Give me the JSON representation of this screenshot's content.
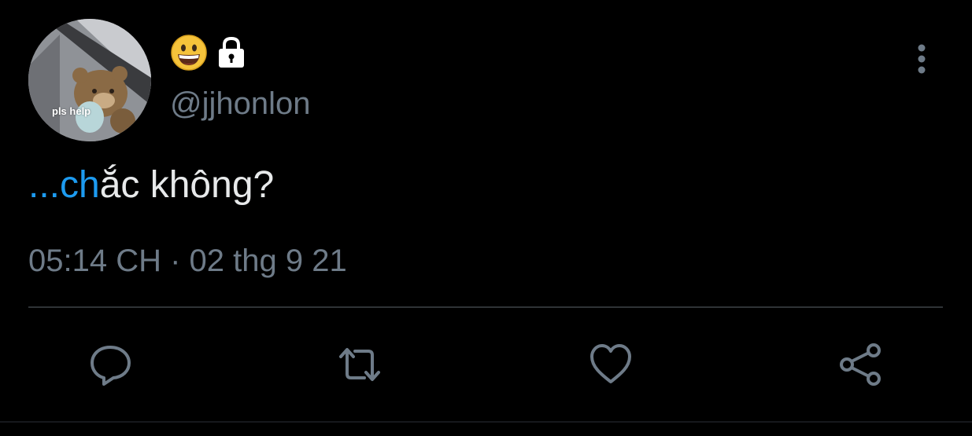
{
  "author": {
    "avatar_caption": "pls help",
    "name_emoji": "grinning-face-emoji",
    "protected_icon": "lock-icon",
    "handle": "@jjhonlon"
  },
  "tweet": {
    "text_link_part": "...ch",
    "text_rest": "ắc không?",
    "timestamp": "05:14 CH · 02 thg 9 21"
  },
  "actions": [
    {
      "name": "reply",
      "icon": "reply-icon"
    },
    {
      "name": "retweet",
      "icon": "retweet-icon"
    },
    {
      "name": "like",
      "icon": "heart-icon"
    },
    {
      "name": "share",
      "icon": "share-icon"
    }
  ],
  "menu": {
    "icon": "more-vertical-icon"
  },
  "colors": {
    "background": "#000000",
    "text": "#e7e9ea",
    "secondary": "#6e7b88",
    "link": "#1d9bf0",
    "divider": "#2f3336"
  }
}
